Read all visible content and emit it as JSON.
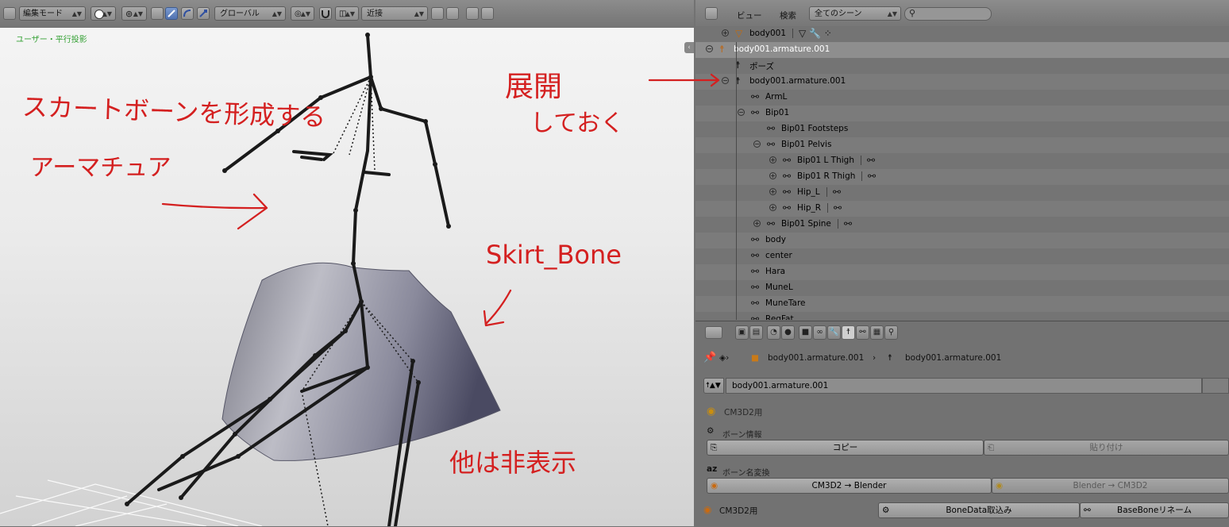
{
  "viewport": {
    "mode": "編集モード",
    "orientation": "グローバル",
    "snap": "近接",
    "view_label": "ユーザー・平行投影"
  },
  "outliner": {
    "menu_view": "ビュー",
    "menu_search": "検索",
    "scene_select": "全てのシーン",
    "rows": [
      {
        "label": "body001",
        "indent": 1,
        "expander": "+",
        "icon": "mesh-icon"
      },
      {
        "label": "body001.armature.001",
        "indent": 0,
        "expander": "-",
        "icon": "armature-object-icon",
        "selected": true
      },
      {
        "label": "ポーズ",
        "indent": 1,
        "expander": "",
        "icon": "pose-icon"
      },
      {
        "label": "body001.armature.001",
        "indent": 1,
        "expander": "-",
        "icon": "armature-data-icon"
      },
      {
        "label": "ArmL",
        "indent": 2,
        "expander": "",
        "icon": "bone-icon"
      },
      {
        "label": "Bip01",
        "indent": 2,
        "expander": "-",
        "icon": "bone-icon"
      },
      {
        "label": "Bip01 Footsteps",
        "indent": 3,
        "expander": "",
        "icon": "bone-icon"
      },
      {
        "label": "Bip01 Pelvis",
        "indent": 3,
        "expander": "-",
        "icon": "bone-icon"
      },
      {
        "label": "Bip01 L Thigh",
        "indent": 4,
        "expander": "+",
        "icon": "bone-icon",
        "child": true
      },
      {
        "label": "Bip01 R Thigh",
        "indent": 4,
        "expander": "+",
        "icon": "bone-icon",
        "child": true
      },
      {
        "label": "Hip_L",
        "indent": 4,
        "expander": "+",
        "icon": "bone-icon",
        "child": true
      },
      {
        "label": "Hip_R",
        "indent": 4,
        "expander": "+",
        "icon": "bone-icon",
        "child": true
      },
      {
        "label": "Bip01 Spine",
        "indent": 3,
        "expander": "+",
        "icon": "bone-icon",
        "child": true
      },
      {
        "label": "body",
        "indent": 2,
        "expander": "",
        "icon": "bone-icon"
      },
      {
        "label": "center",
        "indent": 2,
        "expander": "",
        "icon": "bone-icon"
      },
      {
        "label": "Hara",
        "indent": 2,
        "expander": "",
        "icon": "bone-icon"
      },
      {
        "label": "MuneL",
        "indent": 2,
        "expander": "",
        "icon": "bone-icon"
      },
      {
        "label": "MuneTare",
        "indent": 2,
        "expander": "",
        "icon": "bone-icon"
      },
      {
        "label": "RegFat",
        "indent": 2,
        "expander": "",
        "icon": "bone-icon"
      }
    ]
  },
  "properties": {
    "breadcrumb_object": "body001.armature.001",
    "breadcrumb_data": "body001.armature.001",
    "datablock_name": "body001.armature.001",
    "panel_title": "CM3D2用",
    "bone_info_label": "ボーン情報",
    "copy_button": "コピー",
    "paste_button": "貼り付け",
    "rename_label": "ボーン名変換",
    "to_blender_button": "CM3D2 → Blender",
    "to_cm3d2_button": "Blender → CM3D2",
    "footer_label": "CM3D2用",
    "bonedata_button": "BoneData取込み",
    "basebone_button": "BaseBoneリネーム"
  },
  "annotations": {
    "skirt_armature_line1": "スカートボーンを形成する",
    "skirt_armature_line2": "アーマチュア",
    "expand_line1": "展開",
    "expand_line2": "しておく",
    "skirt_bone": "Skirt_Bone",
    "hide_others": "他は非表示",
    "color": "#d42020"
  }
}
